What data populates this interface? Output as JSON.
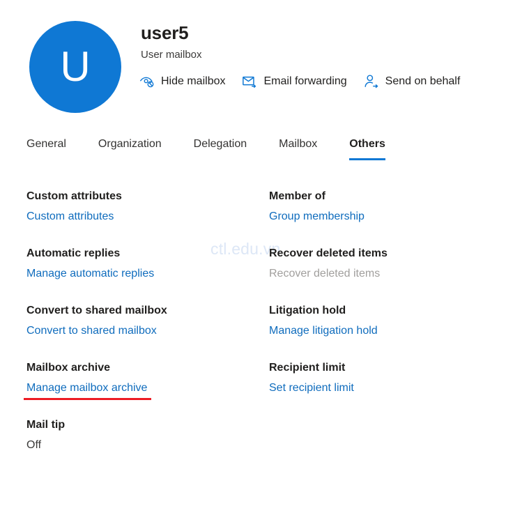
{
  "watermark": "ctl.edu.vn",
  "header": {
    "avatar_initial": "U",
    "avatar_color": "#0f78d4",
    "title": "user5",
    "subtitle": "User mailbox",
    "actions": [
      {
        "label": "Hide mailbox",
        "icon": "eye-hidden-icon"
      },
      {
        "label": "Email forwarding",
        "icon": "envelope-forward-icon"
      },
      {
        "label": "Send on behalf",
        "icon": "person-arrow-icon"
      }
    ]
  },
  "tabs": {
    "items": [
      {
        "label": "General",
        "active": false
      },
      {
        "label": "Organization",
        "active": false
      },
      {
        "label": "Delegation",
        "active": false
      },
      {
        "label": "Mailbox",
        "active": false
      },
      {
        "label": "Others",
        "active": true
      }
    ],
    "active_indicator_color": "#0f78d4"
  },
  "main": {
    "rows": [
      {
        "left": {
          "title": "Custom attributes",
          "link": "Custom attributes",
          "state": "link"
        },
        "right": {
          "title": "Member of",
          "link": "Group membership",
          "state": "link"
        }
      },
      {
        "left": {
          "title": "Automatic replies",
          "link": "Manage automatic replies",
          "state": "link"
        },
        "right": {
          "title": "Recover deleted items",
          "link": "Recover deleted items",
          "state": "disabled"
        }
      },
      {
        "left": {
          "title": "Convert to shared mailbox",
          "link": "Convert to shared mailbox",
          "state": "link"
        },
        "right": {
          "title": "Litigation hold",
          "link": "Manage litigation hold",
          "state": "link"
        }
      },
      {
        "left": {
          "title": "Mailbox archive",
          "link": "Manage mailbox archive",
          "state": "link",
          "annotated": true
        },
        "right": {
          "title": "Recipient limit",
          "link": "Set recipient limit",
          "state": "link"
        }
      },
      {
        "left": {
          "title": "Mail tip",
          "link": "Off",
          "state": "value"
        },
        "right": {
          "title": "",
          "link": "",
          "state": "empty"
        }
      }
    ]
  },
  "colors": {
    "link": "#0f6cbd",
    "disabled": "#a19f9d",
    "accent": "#0f78d4",
    "annotation": "#ed1c24",
    "text": "#201f1e"
  }
}
